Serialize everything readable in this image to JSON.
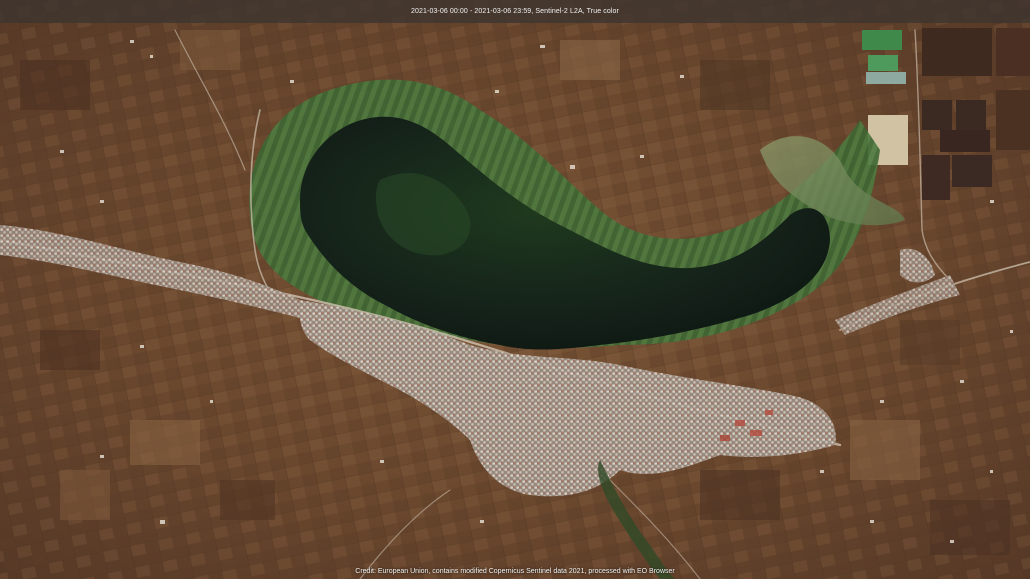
{
  "header": {
    "caption": "2021-03-06 00:00 - 2021-03-06 23:59, Sentinel-2 L2A, True color"
  },
  "footer": {
    "credit": "Credit: European Union, contains modified Copernicus Sentinel data 2021, processed with EO Browser"
  },
  "colors": {
    "terrain": "#6e4a30",
    "lake": "#1b2a1a",
    "vegetation": "#3f6a35",
    "urban": "#c9c3bb",
    "header_bg": "#3c3430"
  }
}
